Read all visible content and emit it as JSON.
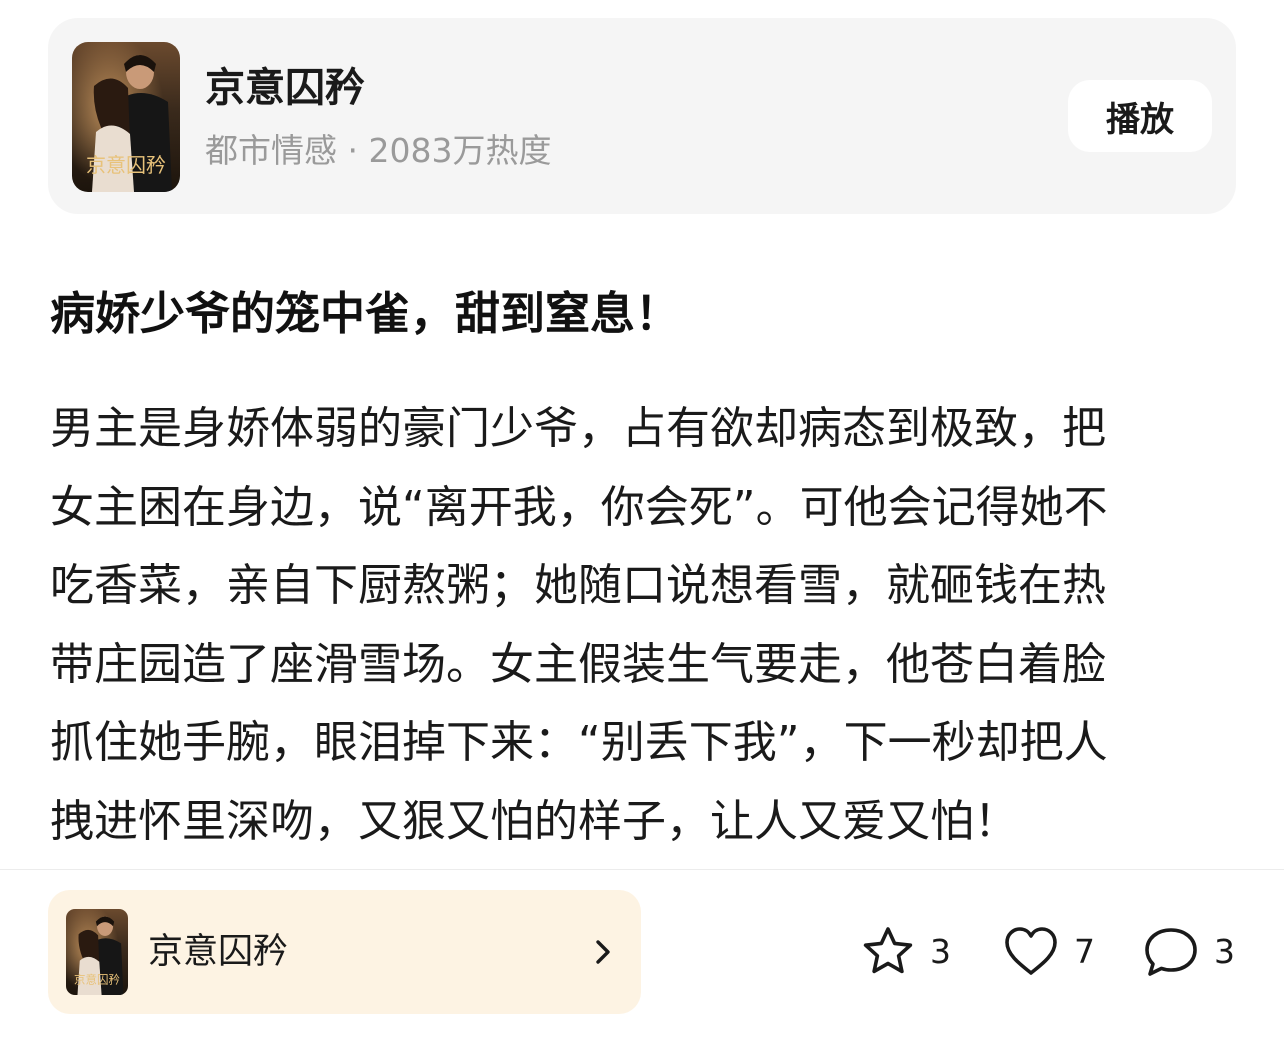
{
  "drama_card": {
    "title": "京意囚矜",
    "meta": "都市情感 · 2083万热度",
    "play_label": "播放",
    "cover_text": "京意囚矜"
  },
  "post": {
    "title": "病娇少爷的笼中雀，甜到窒息！",
    "body_lines": [
      "男主是身娇体弱的豪门少爷，占有欲却病态到极致，把",
      "女主困在身边，说“离开我，你会死”。可他会记得她不",
      "吃香菜，亲自下厨熬粥；她随口说想看雪，就砸钱在热",
      "带庄园造了座滑雪场。女主假装生气要走，他苍白着脸",
      "抓住她手腕，眼泪掉下来：“别丢下我”，下一秒却把人",
      "拽进怀里深吻，又狠又怕的样子，让人又爱又怕！"
    ]
  },
  "bottom_bar": {
    "drama_link": {
      "title": "京意囚矜",
      "cover_text": "京意囚矜",
      "chevron_icon": "chevron-right-icon"
    },
    "actions": {
      "collect": {
        "icon": "star-icon",
        "count": "3"
      },
      "like": {
        "icon": "heart-icon",
        "count": "7"
      },
      "comment": {
        "icon": "comment-bubble-icon",
        "count": "3"
      }
    }
  },
  "colors": {
    "card_bg": "#f5f5f5",
    "link_bg": "#fdf3e3",
    "meta_text": "#9a9a9a",
    "text": "#1a1a1a"
  }
}
